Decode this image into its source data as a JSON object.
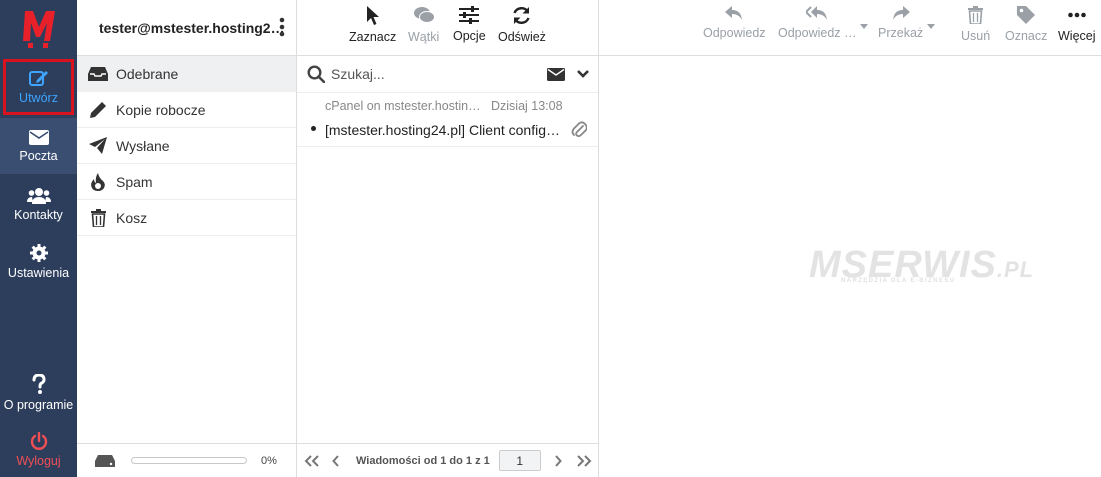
{
  "nav": {
    "compose": "Utwórz",
    "mail": "Poczta",
    "contacts": "Kontakty",
    "settings": "Ustawienia",
    "about": "O programie",
    "logout": "Wyloguj"
  },
  "account": "tester@mstester.hosting2…",
  "folders": [
    {
      "label": "Odebrane",
      "icon": "inbox-icon"
    },
    {
      "label": "Kopie robocze",
      "icon": "pencil-icon"
    },
    {
      "label": "Wysłane",
      "icon": "paper-plane-icon"
    },
    {
      "label": "Spam",
      "icon": "fire-icon"
    },
    {
      "label": "Kosz",
      "icon": "trash-icon"
    }
  ],
  "quota": "0%",
  "toolbar_mid": {
    "select": "Zaznacz",
    "threads": "Wątki",
    "options": "Opcje",
    "refresh": "Odśwież"
  },
  "search": {
    "placeholder": "Szukaj..."
  },
  "messages": [
    {
      "from": "cPanel on mstester.hostin…",
      "date": "Dzisiaj 13:08",
      "subject": "[mstester.hosting24.pl] Client config…",
      "unread": true,
      "attachment": true
    }
  ],
  "pager": {
    "count_text": "Wiadomości od 1 do 1 z 1",
    "page": "1"
  },
  "toolbar_right": {
    "reply": "Odpowiedz",
    "reply_all": "Odpowiedz …",
    "forward": "Przekaż",
    "delete": "Usuń",
    "mark": "Oznacz",
    "more": "Więcej"
  },
  "colors": {
    "nav_bg": "#2c3e5c",
    "accent": "#3ea4ff",
    "logout": "#f24f55",
    "logo": "#e8202a"
  }
}
